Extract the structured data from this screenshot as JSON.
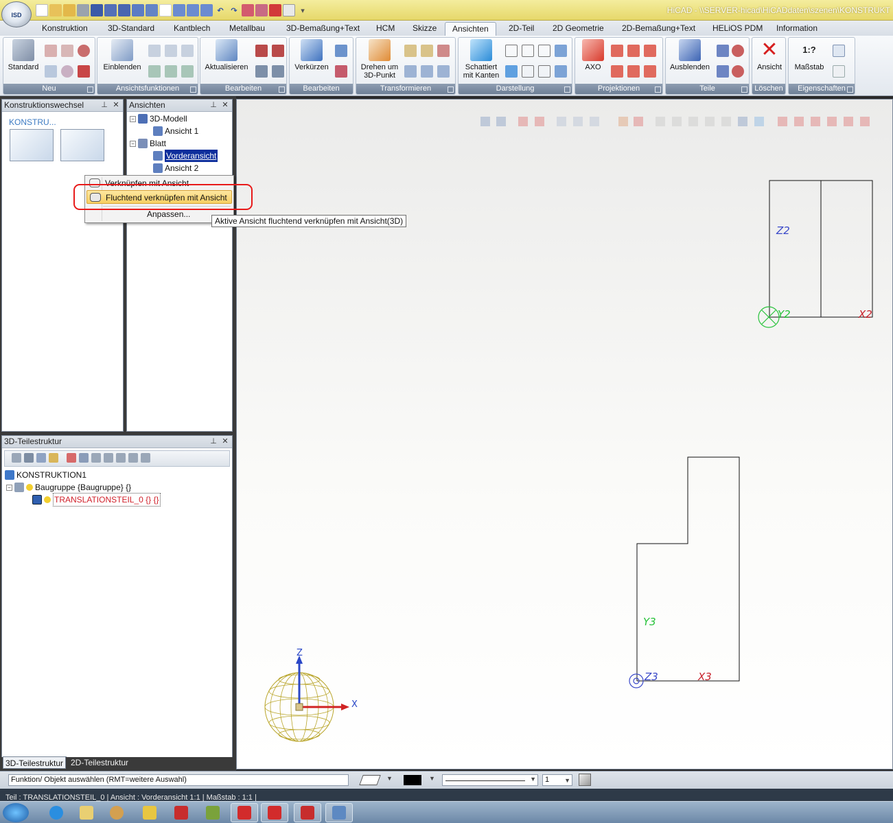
{
  "window": {
    "title": "HiCAD - \\\\SERVER-hicad\\HiCADdaten\\szenen\\KONSTRUKT",
    "logo_text": "ISD"
  },
  "ribbon": {
    "tabs": [
      "Konstruktion",
      "3D-Standard",
      "Kantblech",
      "Metallbau",
      "3D-Bemaßung+Text",
      "HCM",
      "Skizze",
      "Ansichten",
      "2D-Teil",
      "2D Geometrie",
      "2D-Bemaßung+Text",
      "HELiOS PDM",
      "Information"
    ],
    "active_tab": "Ansichten",
    "groups": [
      {
        "label": "Neu",
        "big_button": "Standard"
      },
      {
        "label": "Ansichtsfunktionen",
        "big_button": "Einblenden"
      },
      {
        "label": "Bearbeiten",
        "big_button": "Aktualisieren"
      },
      {
        "label": "Bearbeiten",
        "big_button": "Verkürzen"
      },
      {
        "label": "Transformieren",
        "big_button": "Drehen um 3D-Punkt"
      },
      {
        "label": "Darstellung",
        "big_button": "Schattiert mit Kanten"
      },
      {
        "label": "Projektionen",
        "big_button": "AXO"
      },
      {
        "label": "Teile",
        "big_button": "Ausblenden"
      },
      {
        "label": "Löschen",
        "big_button": "Ansicht"
      },
      {
        "label": "Eigenschaften",
        "big_button": "Maßstab",
        "scale_text": "1:?"
      }
    ]
  },
  "panels": {
    "konstruktionswechsel": {
      "title": "Konstruktionswechsel",
      "item_label": "KONSTRU..."
    },
    "ansichten": {
      "title": "Ansichten",
      "tree": {
        "model": "3D-Modell",
        "model_child": "Ansicht 1",
        "sheet": "Blatt",
        "sheet_child_1": "Vorderansicht",
        "sheet_child_2": "Ansicht 2"
      }
    },
    "teilestruktur": {
      "title": "3D-Teilestruktur",
      "tree": {
        "root": "KONSTRUKTION1",
        "assembly": "Baugruppe {Baugruppe} {}",
        "part": "TRANSLATIONSTEIL_0 {} {}"
      },
      "bottom_tabs": [
        "3D-Teilestruktur",
        "2D-Teilestruktur"
      ]
    }
  },
  "context_menu": {
    "items": [
      "Verknüpfen mit Ansicht",
      "Fluchtend verknüpfen mit Ansicht",
      "Anpassen..."
    ],
    "highlighted": "Fluchtend verknüpfen mit Ansicht",
    "tooltip": "Aktive Ansicht fluchtend verknüpfen mit Ansicht(3D)"
  },
  "viewport": {
    "labels": {
      "z2": "Z2",
      "y2": "Y2",
      "x2": "X2",
      "y3": "Y3",
      "z3": "Z3",
      "x3": "X3",
      "axis_z": "Z",
      "axis_x": "X"
    },
    "colors": {
      "blue_label": "#3a49c9",
      "green_label": "#27c23a",
      "red_label": "#c8232c",
      "outline": "#111111"
    }
  },
  "command_bar": {
    "prompt": "Funktion/ Objekt auswählen (RMT=weitere Auswahl)",
    "line_width": "1"
  },
  "status_bar": {
    "text": "Teil : TRANSLATIONSTEIL_0  |  Ansicht : Vorderansicht  1:1  |  Maßstab : 1:1  |"
  },
  "taskbar": {
    "icons": [
      "start-orb-icon",
      "ie-icon",
      "explorer-icon",
      "paint-icon",
      "app-icon",
      "hicad-icon",
      "tool-icon",
      "sw-icon",
      "sw-icon",
      "hicad-icon",
      "remote-icon"
    ]
  }
}
